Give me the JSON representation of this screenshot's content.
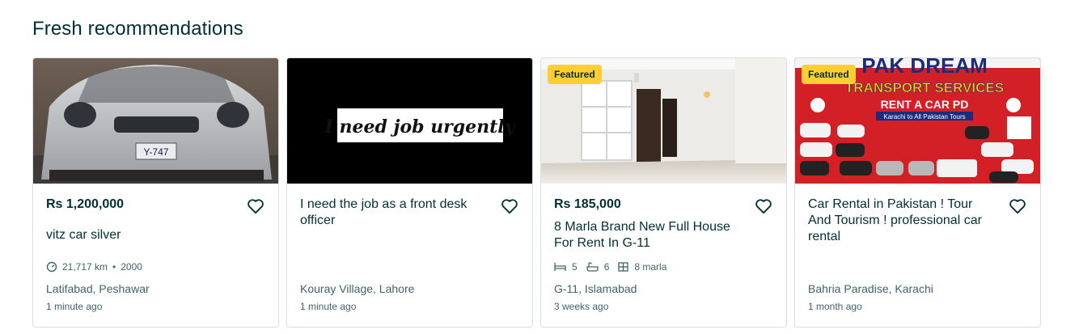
{
  "section": {
    "title": "Fresh recommendations"
  },
  "cards": [
    {
      "price": "Rs 1,200,000",
      "title": "vitz car silver",
      "mileage": "21,717 km",
      "year": "2000",
      "location": "Latifabad, Peshawar",
      "time": "1 minute ago",
      "plate": "Y-747"
    },
    {
      "title": "I need the job as a front desk officer",
      "image_text": "I need job urgently",
      "location": "Kouray Village, Lahore",
      "time": "1 minute ago"
    },
    {
      "badge": "Featured",
      "price": "Rs 185,000",
      "title": "8 Marla Brand New Full House For Rent In G-11",
      "beds": "5",
      "baths": "6",
      "area": "8 marla",
      "location": "G-11, Islamabad",
      "time": "3 weeks ago"
    },
    {
      "badge": "Featured",
      "title": "Car Rental in Pakistan ! Tour And Tourism ! professional car rental",
      "banner_line1": "PAK DREAM",
      "banner_line2": "TRANSPORT SERVICES",
      "banner_line3": "RENT A CAR PD",
      "banner_line4": "Karachi to All Pakistan Tours",
      "location": "Bahria Paradise, Karachi",
      "time": "1 month ago"
    }
  ],
  "icons": {
    "heart": "heart-icon",
    "odometer": "speedometer-icon",
    "bed": "bed-icon",
    "bath": "bath-icon",
    "area": "area-icon"
  }
}
